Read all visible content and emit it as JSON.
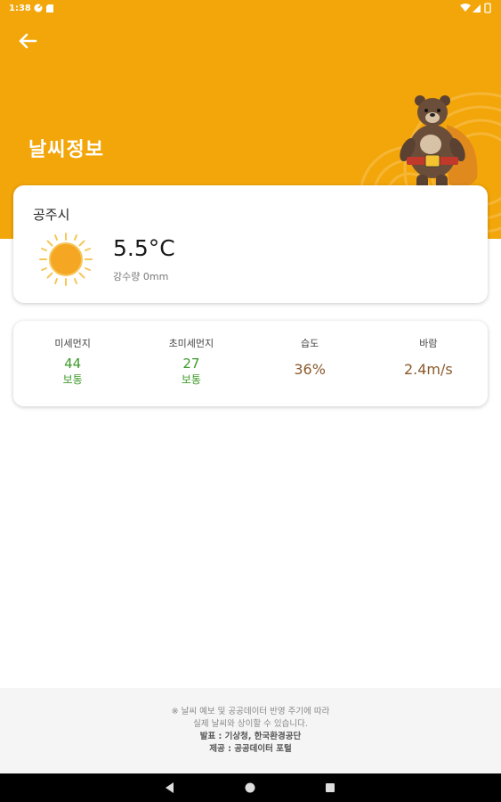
{
  "status_bar": {
    "time": "1:38",
    "left_icons": [
      "gauge-icon",
      "sd-card-icon"
    ],
    "right_icons": [
      "wifi-icon",
      "signal-icon",
      "battery-icon"
    ]
  },
  "header": {
    "title": "날씨정보",
    "back_icon": "arrow-left-icon",
    "background_color": "#F2A60A"
  },
  "weather": {
    "city": "공주시",
    "icon": "sun-icon",
    "temperature": "5.5°C",
    "rainfall": "강수량 0mm"
  },
  "stats": [
    {
      "label": "미세먼지",
      "value": "44",
      "status": "보통",
      "color": "#3E9A2A"
    },
    {
      "label": "초미세먼지",
      "value": "27",
      "status": "보통",
      "color": "#3E9A2A"
    },
    {
      "label": "습도",
      "value": "36%",
      "color": "#8B5A2B"
    },
    {
      "label": "바람",
      "value": "2.4m/s",
      "color": "#8B5A2B"
    }
  ],
  "footer": {
    "notice_line1": "※ 날씨 예보 및 공공데이터 반영 주기에 따라",
    "notice_line2": "실제 날씨와 상이할 수 있습니다.",
    "source": "발표 : 기상청, 한국환경공단",
    "provider": "제공 : 공공데이터 포털"
  },
  "nav_bar": {
    "buttons": [
      "back-triangle-icon",
      "home-circle-icon",
      "recents-square-icon"
    ]
  }
}
